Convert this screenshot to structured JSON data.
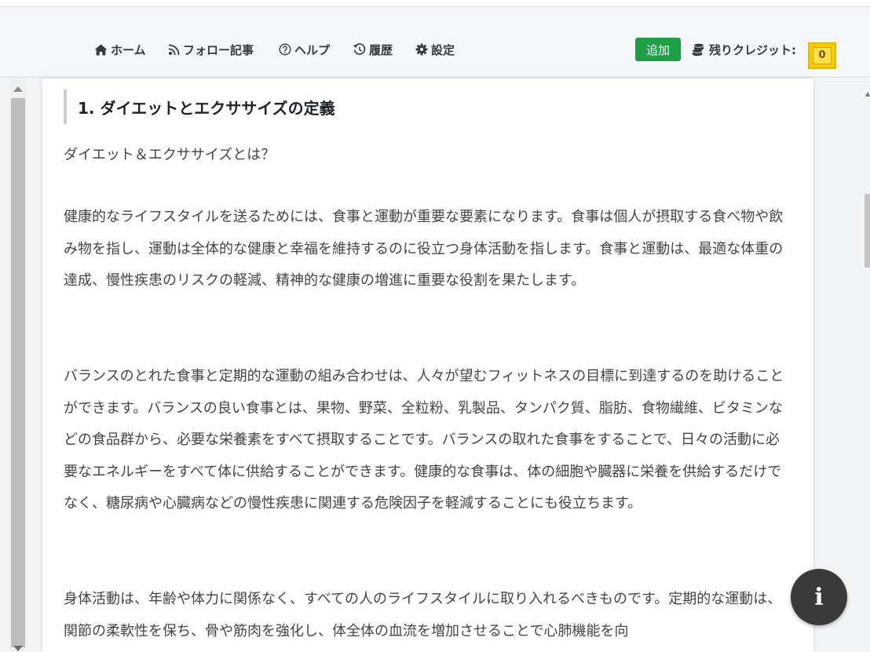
{
  "nav": {
    "home": "ホーム",
    "follow": "フォロー記事",
    "help": "ヘルプ",
    "history": "履歴",
    "settings": "設定",
    "add_label": "追加",
    "credits_label": "残りクレジット:",
    "credits_value": "0"
  },
  "colors": {
    "add_button": "#1e9e46",
    "credit_badge": "#f6c90e",
    "info_button": "#3a3a3a"
  },
  "icons": {
    "home": "home-icon",
    "follow": "rss-icon",
    "help": "question-circle-icon",
    "history": "history-icon",
    "settings": "gear-icon",
    "credits": "coins-icon",
    "info": "info-icon"
  },
  "article": {
    "heading": "1. ダイエットとエクササイズの定義",
    "intro": "ダイエット＆エクササイズとは？",
    "paragraphs": [
      "健康的なライフスタイルを送るためには、食事と運動が重要な要素になります。食事は個人が摂取する食べ物や飲み物を指し、運動は全体的な健康と幸福を維持するのに役立つ身体活動を指します。食事と運動は、最適な体重の達成、慢性疾患のリスクの軽減、精神的な健康の増進に重要な役割を果たします。",
      "バランスのとれた食事と定期的な運動の組み合わせは、人々が望むフィットネスの目標に到達するのを助けることができます。バランスの良い食事とは、果物、野菜、全粒粉、乳製品、タンパク質、脂肪、食物繊維、ビタミンなどの食品群から、必要な栄養素をすべて摂取することです。バランスの取れた食事をすることで、日々の活動に必要なエネルギーをすべて体に供給することができます。健康的な食事は、体の細胞や臓器に栄養を供給するだけでなく、糖尿病や心臓病などの慢性疾患に関連する危険因子を軽減することにも役立ちます。",
      "身体活動は、年齢や体力に関係なく、すべての人のライフスタイルに取り入れるべきものです。定期的な運動は、関節の柔軟性を保ち、骨や筋肉を強化し、体全体の血流を増加させることで心肺機能を向"
    ]
  }
}
